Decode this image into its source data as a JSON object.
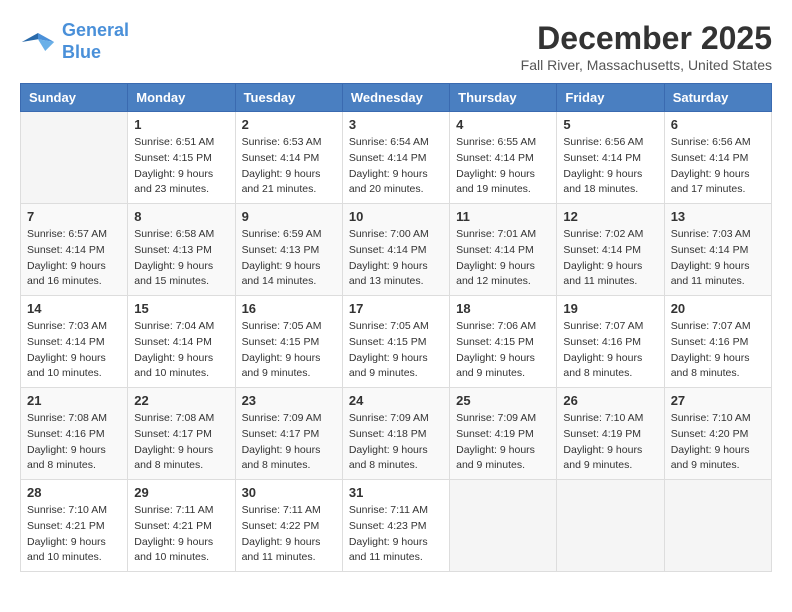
{
  "logo": {
    "line1": "General",
    "line2": "Blue"
  },
  "title": "December 2025",
  "location": "Fall River, Massachusetts, United States",
  "weekdays": [
    "Sunday",
    "Monday",
    "Tuesday",
    "Wednesday",
    "Thursday",
    "Friday",
    "Saturday"
  ],
  "weeks": [
    [
      {
        "day": "",
        "sunrise": "",
        "sunset": "",
        "daylight": ""
      },
      {
        "day": "1",
        "sunrise": "Sunrise: 6:51 AM",
        "sunset": "Sunset: 4:15 PM",
        "daylight": "Daylight: 9 hours and 23 minutes."
      },
      {
        "day": "2",
        "sunrise": "Sunrise: 6:53 AM",
        "sunset": "Sunset: 4:14 PM",
        "daylight": "Daylight: 9 hours and 21 minutes."
      },
      {
        "day": "3",
        "sunrise": "Sunrise: 6:54 AM",
        "sunset": "Sunset: 4:14 PM",
        "daylight": "Daylight: 9 hours and 20 minutes."
      },
      {
        "day": "4",
        "sunrise": "Sunrise: 6:55 AM",
        "sunset": "Sunset: 4:14 PM",
        "daylight": "Daylight: 9 hours and 19 minutes."
      },
      {
        "day": "5",
        "sunrise": "Sunrise: 6:56 AM",
        "sunset": "Sunset: 4:14 PM",
        "daylight": "Daylight: 9 hours and 18 minutes."
      },
      {
        "day": "6",
        "sunrise": "Sunrise: 6:56 AM",
        "sunset": "Sunset: 4:14 PM",
        "daylight": "Daylight: 9 hours and 17 minutes."
      }
    ],
    [
      {
        "day": "7",
        "sunrise": "Sunrise: 6:57 AM",
        "sunset": "Sunset: 4:14 PM",
        "daylight": "Daylight: 9 hours and 16 minutes."
      },
      {
        "day": "8",
        "sunrise": "Sunrise: 6:58 AM",
        "sunset": "Sunset: 4:13 PM",
        "daylight": "Daylight: 9 hours and 15 minutes."
      },
      {
        "day": "9",
        "sunrise": "Sunrise: 6:59 AM",
        "sunset": "Sunset: 4:13 PM",
        "daylight": "Daylight: 9 hours and 14 minutes."
      },
      {
        "day": "10",
        "sunrise": "Sunrise: 7:00 AM",
        "sunset": "Sunset: 4:14 PM",
        "daylight": "Daylight: 9 hours and 13 minutes."
      },
      {
        "day": "11",
        "sunrise": "Sunrise: 7:01 AM",
        "sunset": "Sunset: 4:14 PM",
        "daylight": "Daylight: 9 hours and 12 minutes."
      },
      {
        "day": "12",
        "sunrise": "Sunrise: 7:02 AM",
        "sunset": "Sunset: 4:14 PM",
        "daylight": "Daylight: 9 hours and 11 minutes."
      },
      {
        "day": "13",
        "sunrise": "Sunrise: 7:03 AM",
        "sunset": "Sunset: 4:14 PM",
        "daylight": "Daylight: 9 hours and 11 minutes."
      }
    ],
    [
      {
        "day": "14",
        "sunrise": "Sunrise: 7:03 AM",
        "sunset": "Sunset: 4:14 PM",
        "daylight": "Daylight: 9 hours and 10 minutes."
      },
      {
        "day": "15",
        "sunrise": "Sunrise: 7:04 AM",
        "sunset": "Sunset: 4:14 PM",
        "daylight": "Daylight: 9 hours and 10 minutes."
      },
      {
        "day": "16",
        "sunrise": "Sunrise: 7:05 AM",
        "sunset": "Sunset: 4:15 PM",
        "daylight": "Daylight: 9 hours and 9 minutes."
      },
      {
        "day": "17",
        "sunrise": "Sunrise: 7:05 AM",
        "sunset": "Sunset: 4:15 PM",
        "daylight": "Daylight: 9 hours and 9 minutes."
      },
      {
        "day": "18",
        "sunrise": "Sunrise: 7:06 AM",
        "sunset": "Sunset: 4:15 PM",
        "daylight": "Daylight: 9 hours and 9 minutes."
      },
      {
        "day": "19",
        "sunrise": "Sunrise: 7:07 AM",
        "sunset": "Sunset: 4:16 PM",
        "daylight": "Daylight: 9 hours and 8 minutes."
      },
      {
        "day": "20",
        "sunrise": "Sunrise: 7:07 AM",
        "sunset": "Sunset: 4:16 PM",
        "daylight": "Daylight: 9 hours and 8 minutes."
      }
    ],
    [
      {
        "day": "21",
        "sunrise": "Sunrise: 7:08 AM",
        "sunset": "Sunset: 4:16 PM",
        "daylight": "Daylight: 9 hours and 8 minutes."
      },
      {
        "day": "22",
        "sunrise": "Sunrise: 7:08 AM",
        "sunset": "Sunset: 4:17 PM",
        "daylight": "Daylight: 9 hours and 8 minutes."
      },
      {
        "day": "23",
        "sunrise": "Sunrise: 7:09 AM",
        "sunset": "Sunset: 4:17 PM",
        "daylight": "Daylight: 9 hours and 8 minutes."
      },
      {
        "day": "24",
        "sunrise": "Sunrise: 7:09 AM",
        "sunset": "Sunset: 4:18 PM",
        "daylight": "Daylight: 9 hours and 8 minutes."
      },
      {
        "day": "25",
        "sunrise": "Sunrise: 7:09 AM",
        "sunset": "Sunset: 4:19 PM",
        "daylight": "Daylight: 9 hours and 9 minutes."
      },
      {
        "day": "26",
        "sunrise": "Sunrise: 7:10 AM",
        "sunset": "Sunset: 4:19 PM",
        "daylight": "Daylight: 9 hours and 9 minutes."
      },
      {
        "day": "27",
        "sunrise": "Sunrise: 7:10 AM",
        "sunset": "Sunset: 4:20 PM",
        "daylight": "Daylight: 9 hours and 9 minutes."
      }
    ],
    [
      {
        "day": "28",
        "sunrise": "Sunrise: 7:10 AM",
        "sunset": "Sunset: 4:21 PM",
        "daylight": "Daylight: 9 hours and 10 minutes."
      },
      {
        "day": "29",
        "sunrise": "Sunrise: 7:11 AM",
        "sunset": "Sunset: 4:21 PM",
        "daylight": "Daylight: 9 hours and 10 minutes."
      },
      {
        "day": "30",
        "sunrise": "Sunrise: 7:11 AM",
        "sunset": "Sunset: 4:22 PM",
        "daylight": "Daylight: 9 hours and 11 minutes."
      },
      {
        "day": "31",
        "sunrise": "Sunrise: 7:11 AM",
        "sunset": "Sunset: 4:23 PM",
        "daylight": "Daylight: 9 hours and 11 minutes."
      },
      {
        "day": "",
        "sunrise": "",
        "sunset": "",
        "daylight": ""
      },
      {
        "day": "",
        "sunrise": "",
        "sunset": "",
        "daylight": ""
      },
      {
        "day": "",
        "sunrise": "",
        "sunset": "",
        "daylight": ""
      }
    ]
  ]
}
